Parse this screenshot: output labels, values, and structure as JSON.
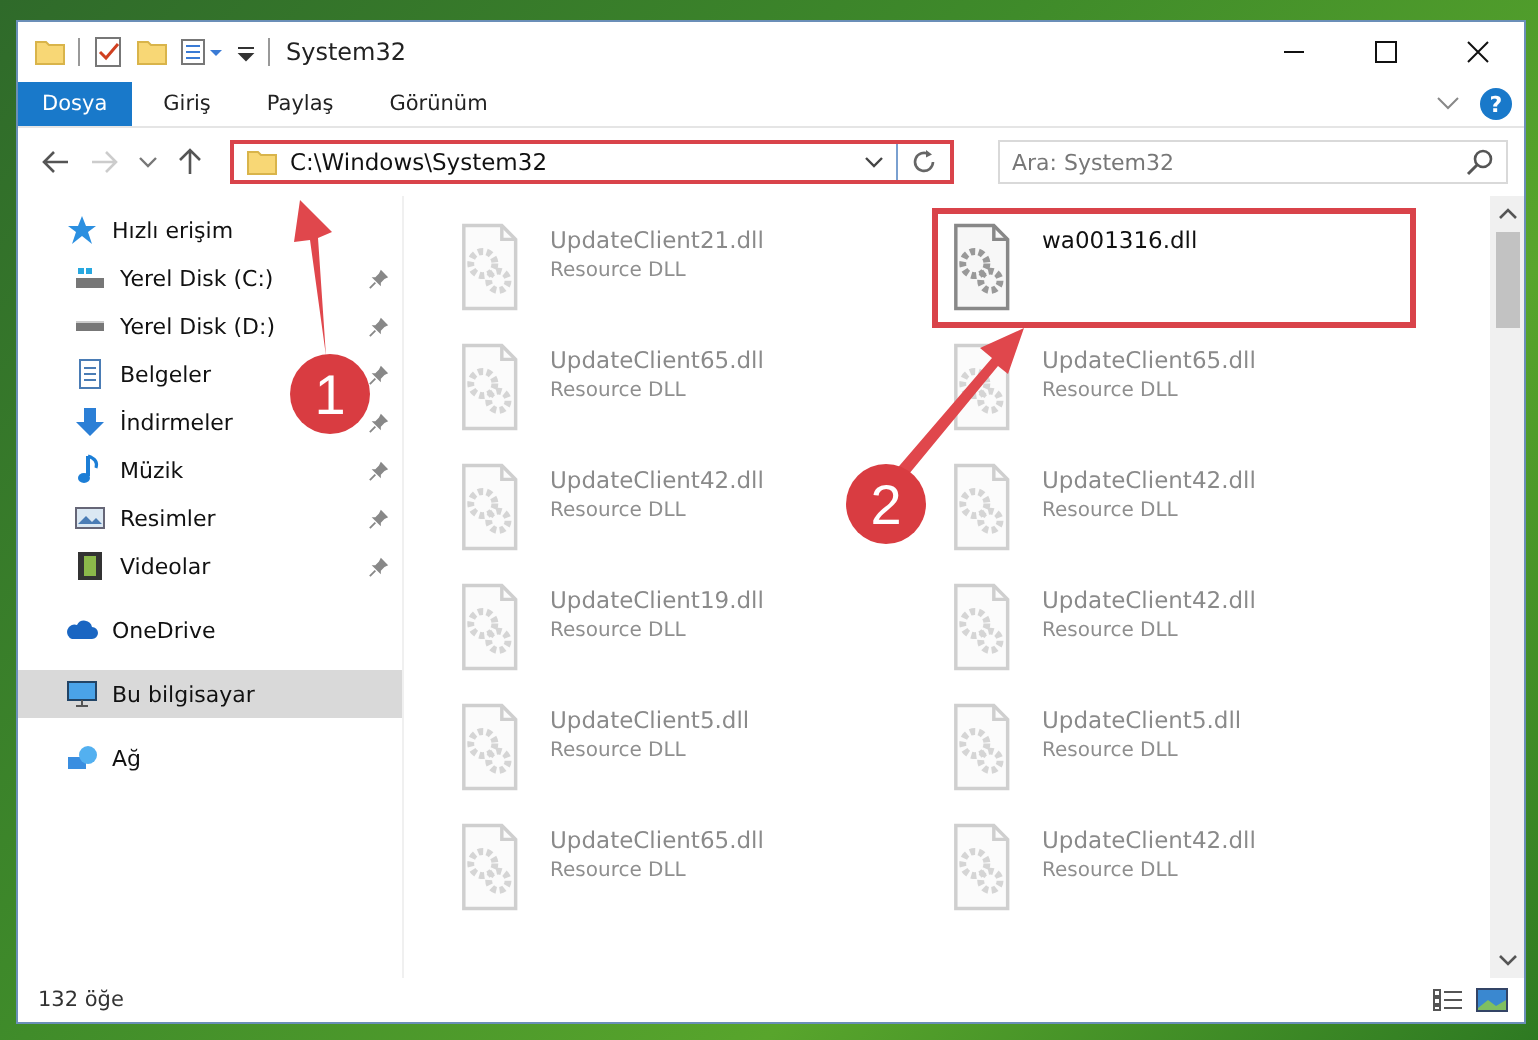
{
  "window": {
    "title": "System32"
  },
  "ribbon": {
    "tabs": [
      {
        "label": "Dosya",
        "selected": true
      },
      {
        "label": "Giriş",
        "selected": false
      },
      {
        "label": "Paylaş",
        "selected": false
      },
      {
        "label": "Görünüm",
        "selected": false
      }
    ],
    "help": "?"
  },
  "address_bar": {
    "path": "C:\\Windows\\System32",
    "highlighted": true
  },
  "search": {
    "placeholder": "Ara: System32"
  },
  "sidebar": {
    "items": [
      {
        "label": "Hızlı erişim",
        "selected": false,
        "children": [
          {
            "label": "Yerel Disk (C:)",
            "pinned": true,
            "selected": false
          },
          {
            "label": "Yerel Disk (D:)",
            "pinned": true,
            "selected": false
          },
          {
            "label": "Belgeler",
            "pinned": true,
            "selected": false
          },
          {
            "label": "İndirmeler",
            "pinned": true,
            "selected": false
          },
          {
            "label": "Müzik",
            "pinned": true,
            "selected": false
          },
          {
            "label": "Resimler",
            "pinned": true,
            "selected": false
          },
          {
            "label": "Videolar",
            "pinned": true,
            "selected": false
          }
        ]
      },
      {
        "label": "OneDrive",
        "selected": false
      },
      {
        "label": "Bu bilgisayar",
        "selected": true
      },
      {
        "label": "Ağ",
        "selected": false
      }
    ]
  },
  "files": [
    {
      "name": "UpdateClient21.dll",
      "type": "Resource DLL",
      "blurred": true,
      "highlighted": false
    },
    {
      "name": "wa001316.dll",
      "blurred": false,
      "highlighted": true
    },
    {
      "name": "UpdateClient65.dll",
      "type": "Resource DLL",
      "blurred": true,
      "highlighted": false
    },
    {
      "name": "UpdateClient65.dll",
      "type": "Resource DLL",
      "blurred": true,
      "highlighted": false
    },
    {
      "name": "UpdateClient42.dll",
      "type": "Resource DLL",
      "blurred": true,
      "highlighted": false
    },
    {
      "name": "UpdateClient42.dll",
      "type": "Resource DLL",
      "blurred": true,
      "highlighted": false
    },
    {
      "name": "UpdateClient19.dll",
      "type": "Resource DLL",
      "blurred": true,
      "highlighted": false
    },
    {
      "name": "UpdateClient42.dll",
      "type": "Resource DLL",
      "blurred": true,
      "highlighted": false
    },
    {
      "name": "UpdateClient5.dll",
      "type": "Resource DLL",
      "blurred": true,
      "highlighted": false
    },
    {
      "name": "UpdateClient5.dll",
      "type": "Resource DLL",
      "blurred": true,
      "highlighted": false
    },
    {
      "name": "UpdateClient65.dll",
      "type": "Resource DLL",
      "blurred": true,
      "highlighted": false
    },
    {
      "name": "UpdateClient42.dll",
      "type": "Resource DLL",
      "blurred": true,
      "highlighted": false
    }
  ],
  "status_bar": {
    "count": "132 öğe"
  },
  "annotations": [
    {
      "number": "1"
    },
    {
      "number": "2"
    }
  ]
}
